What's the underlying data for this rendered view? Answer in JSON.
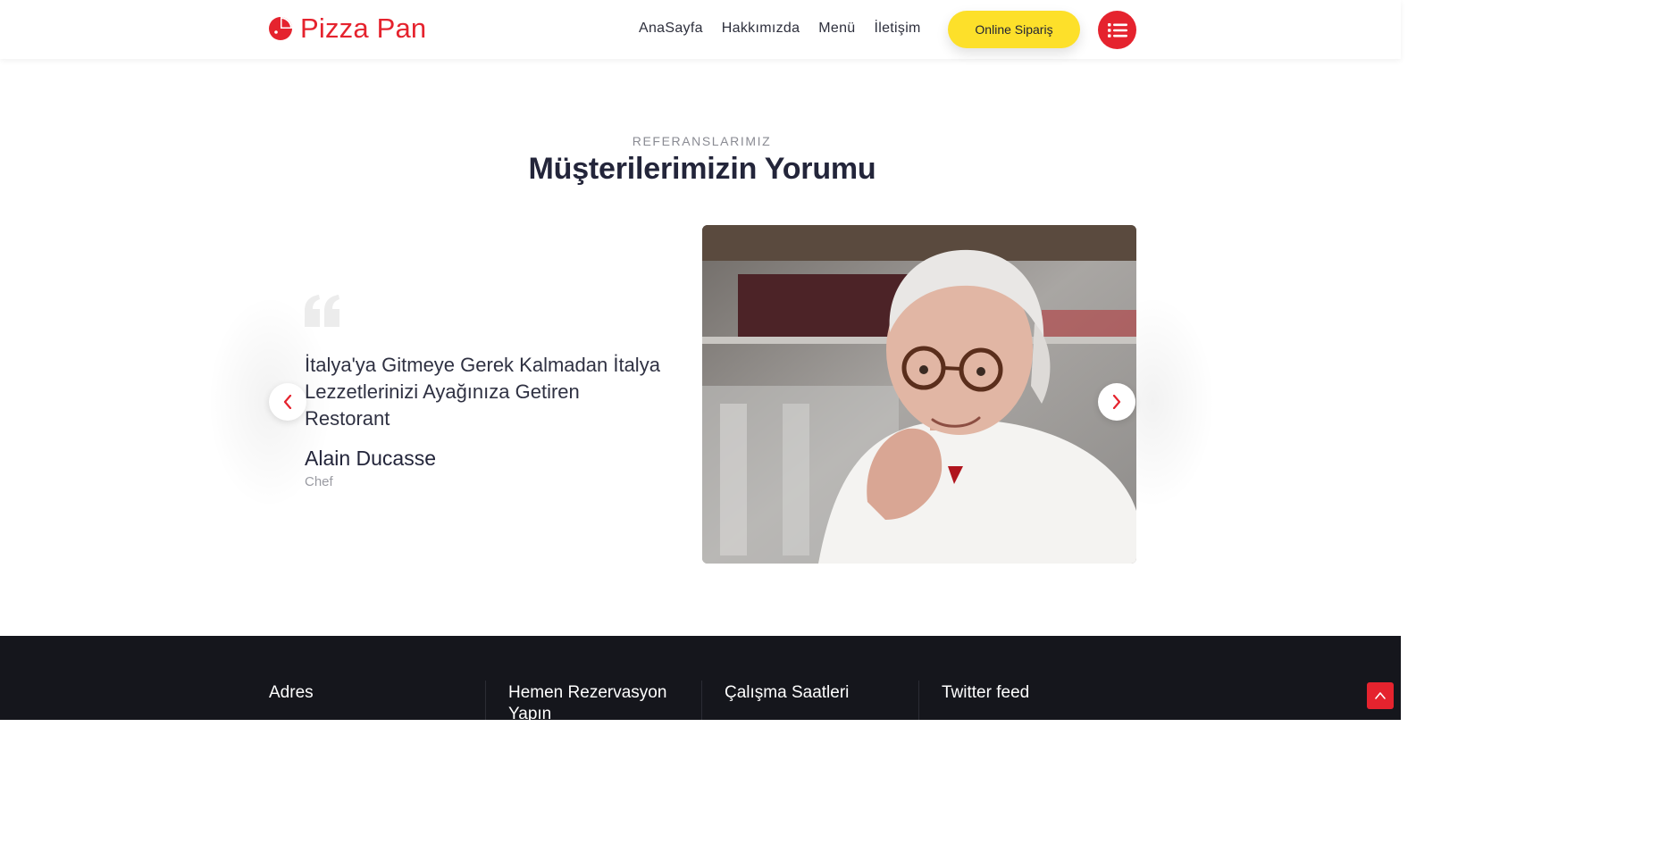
{
  "header": {
    "logo_text": "Pizza Pan",
    "nav": [
      "AnaSayfa",
      "Hakkımızda",
      "Menü",
      "İletişim"
    ],
    "order_button": "Online Sipariş",
    "menu_icon": "list-icon"
  },
  "testimonials": {
    "eyebrow": "REFERANSLARIMIZ",
    "title": "Müşterilerimizin Yorumu",
    "quote": "İtalya'ya Gitmeye Gerek Kalmadan İtalya Lezzetlerinizi Ayağınıza Getiren Restorant",
    "author": "Alain Ducasse",
    "role": "Chef",
    "prev_icon": "chevron-left-icon",
    "next_icon": "chevron-right-icon"
  },
  "footer": {
    "columns": [
      "Adres",
      "Hemen Rezervasyon Yapın",
      "Çalışma Saatleri",
      "Twitter feed"
    ]
  },
  "colors": {
    "brand_red": "#e5232e",
    "accent_yellow": "#fde02a",
    "footer_bg": "#15161c",
    "text_dark": "#23253a"
  }
}
